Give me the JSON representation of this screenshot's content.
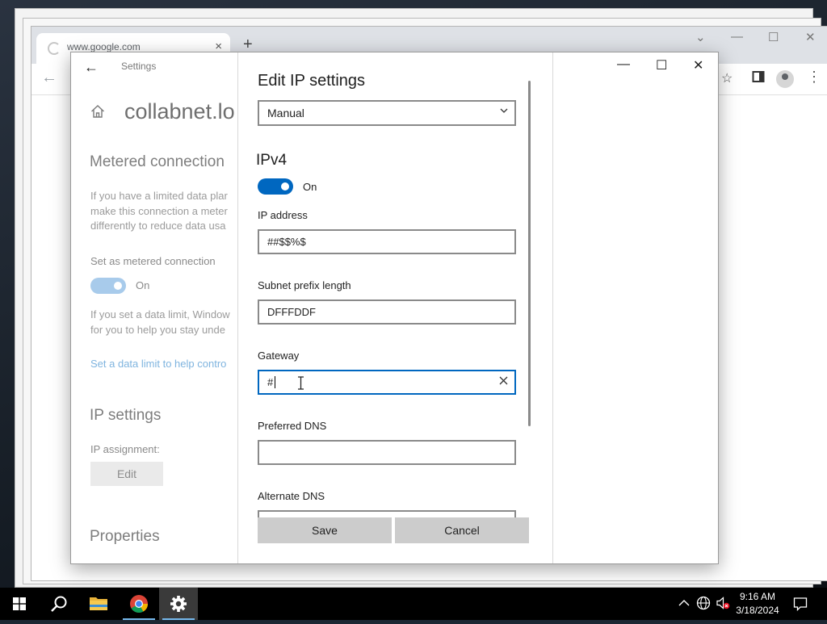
{
  "browser": {
    "tab_title": "www.google.com",
    "new_tab": "+",
    "close_tab": "×"
  },
  "settings_window": {
    "app_title": "Settings",
    "back": "←",
    "minimize": "—",
    "maximize": "☐",
    "close": "✕",
    "network_name": "collabnet.lo",
    "metered": {
      "heading": "Metered connection",
      "description": [
        "If you have a limited data plar",
        "make this connection a meter",
        "differently to reduce data usa"
      ],
      "set_label": "Set as metered connection",
      "toggle_state": "On",
      "limit_text": [
        "If you set a data limit, Window",
        "for you to help you stay unde"
      ],
      "link": "Set a data limit to help contro"
    },
    "ip_settings": {
      "heading": "IP settings",
      "assignment_label": "IP assignment:",
      "edit_button": "Edit"
    },
    "properties_heading": "Properties"
  },
  "dialog": {
    "title": "Edit IP settings",
    "mode_selected": "Manual",
    "ipv4_heading": "IPv4",
    "ipv4_toggle": "On",
    "fields": [
      {
        "label": "IP address",
        "value": "##$$%$"
      },
      {
        "label": "Subnet prefix length",
        "value": "DFFFDDF"
      },
      {
        "label": "Gateway",
        "value": "#"
      },
      {
        "label": "Preferred DNS",
        "value": ""
      },
      {
        "label": "Alternate DNS",
        "value": ""
      }
    ],
    "save_button": "Save",
    "cancel_button": "Cancel"
  },
  "taskbar": {
    "time": "9:16 AM",
    "date": "3/18/2024"
  },
  "colors": {
    "accent": "#0067c0",
    "accent_dim": "#a8cbeb",
    "link": "#7fb4df",
    "taskbar": "#000000"
  },
  "icons": [
    "back-arrow-icon",
    "home-icon",
    "chevron-down-icon",
    "clear-icon",
    "text-cursor-icon",
    "windows-start-icon",
    "search-icon",
    "file-explorer-icon",
    "chrome-icon",
    "settings-gear-icon",
    "chevron-up-icon",
    "globe-icon",
    "speaker-muted-icon",
    "notification-icon",
    "star-icon",
    "sidebar-icon",
    "profile-icon"
  ]
}
